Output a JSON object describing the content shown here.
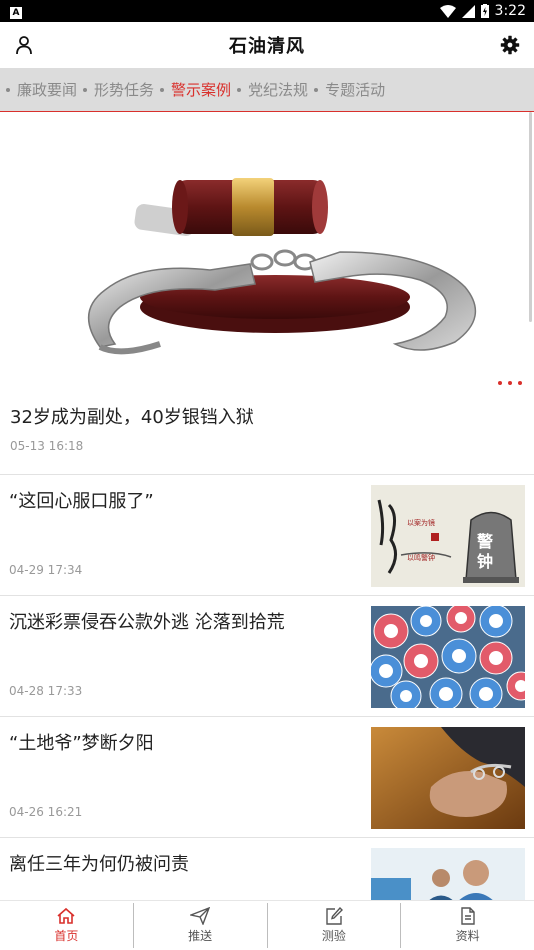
{
  "status": {
    "time": "3:22"
  },
  "header": {
    "title": "石油清风",
    "user_icon": "person-icon",
    "settings_icon": "gear-icon"
  },
  "tabs": [
    {
      "label": "廉政要闻",
      "active": false
    },
    {
      "label": "形势任务",
      "active": false
    },
    {
      "label": "警示案例",
      "active": true
    },
    {
      "label": "党纪法规",
      "active": false
    },
    {
      "label": "专题活动",
      "active": false
    }
  ],
  "colors": {
    "accent": "#d9302c",
    "tab_bg": "#dcdcdc",
    "muted": "#999999"
  },
  "featured": {
    "title": "32岁成为副处，40岁银铛入狱",
    "date": "05-13 16:18"
  },
  "news": [
    {
      "title": "“这回心服口服了”",
      "date": "04-29 17:34",
      "thumb": "bell-calligraphy-image",
      "thumb_text": {
        "bell": "警钟",
        "seal": "以案为镜 以鸣警钟"
      }
    },
    {
      "title": "沉迷彩票侵吞公款外逃 沦落到拾荒",
      "date": "04-28 17:33",
      "thumb": "lottery-balls-image",
      "thumb_text": {}
    },
    {
      "title": "“土地爷”梦断夕阳",
      "date": "04-26 16:21",
      "thumb": "handcuffed-hands-image",
      "thumb_text": {}
    },
    {
      "title": "离任三年为何仍被问责",
      "date": "",
      "thumb": "office-meeting-image",
      "thumb_text": {}
    }
  ],
  "bottom_nav": [
    {
      "label": "首页",
      "icon": "home-icon",
      "active": true
    },
    {
      "label": "推送",
      "icon": "send-icon",
      "active": false
    },
    {
      "label": "测验",
      "icon": "edit-icon",
      "active": false
    },
    {
      "label": "资料",
      "icon": "document-icon",
      "active": false
    }
  ]
}
